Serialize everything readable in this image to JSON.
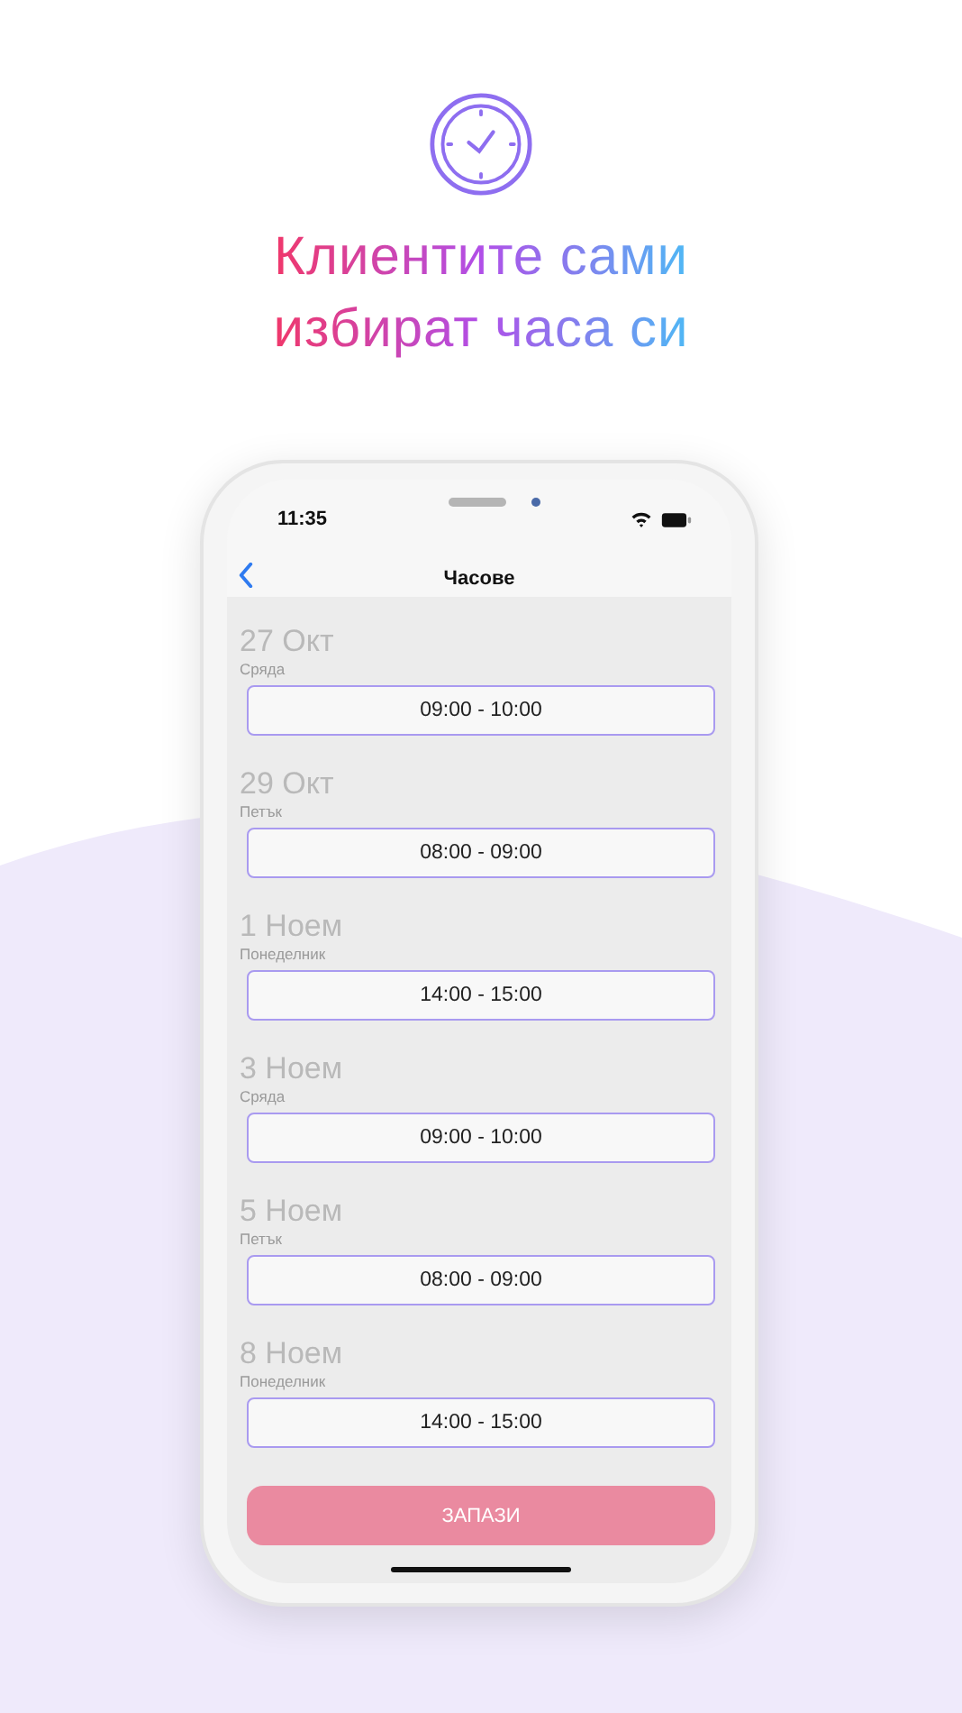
{
  "headline": [
    "Клиентите сами",
    "избират часа си"
  ],
  "status_bar": {
    "time": "11:35"
  },
  "nav": {
    "title": "Часове"
  },
  "days": [
    {
      "date": "27 Окт",
      "weekday": "Сряда",
      "slot": "09:00 - 10:00"
    },
    {
      "date": "29 Окт",
      "weekday": "Петък",
      "slot": "08:00 - 09:00"
    },
    {
      "date": "1 Ноем",
      "weekday": "Понеделник",
      "slot": "14:00 - 15:00"
    },
    {
      "date": "3 Ноем",
      "weekday": "Сряда",
      "slot": "09:00 - 10:00"
    },
    {
      "date": "5 Ноем",
      "weekday": "Петък",
      "slot": "08:00 - 09:00"
    },
    {
      "date": "8 Ноем",
      "weekday": "Понеделник",
      "slot": "14:00 - 15:00"
    }
  ],
  "save_button": {
    "label": "ЗАПАЗИ",
    "disabled": true
  }
}
